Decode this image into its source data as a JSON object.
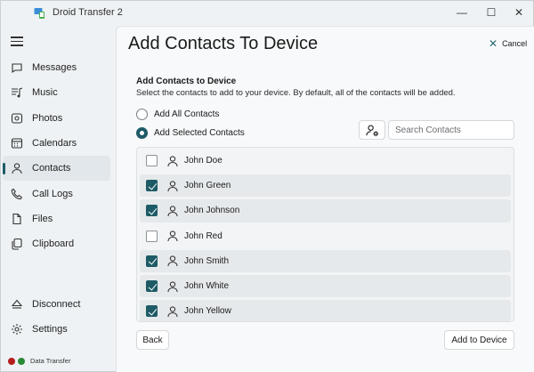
{
  "window": {
    "title": "Droid Transfer 2",
    "controls": {
      "minimize": "—",
      "maximize": "☐",
      "close": "✕"
    }
  },
  "sidebar": {
    "items": [
      {
        "label": "Messages",
        "icon": "messages-icon",
        "active": false
      },
      {
        "label": "Music",
        "icon": "music-icon",
        "active": false
      },
      {
        "label": "Photos",
        "icon": "photos-icon",
        "active": false
      },
      {
        "label": "Calendars",
        "icon": "calendar-icon",
        "active": false
      },
      {
        "label": "Contacts",
        "icon": "contacts-icon",
        "active": true
      },
      {
        "label": "Call Logs",
        "icon": "phone-icon",
        "active": false
      },
      {
        "label": "Files",
        "icon": "file-icon",
        "active": false
      },
      {
        "label": "Clipboard",
        "icon": "clipboard-icon",
        "active": false
      }
    ],
    "bottom_items": [
      {
        "label": "Disconnect",
        "icon": "eject-icon"
      },
      {
        "label": "Settings",
        "icon": "gear-icon"
      }
    ],
    "status": {
      "label": "Data Transfer",
      "colors": [
        "#b51c1c",
        "#2a8a36"
      ]
    }
  },
  "header": {
    "title": "Add Contacts To Device",
    "cancel_label": "Cancel"
  },
  "content": {
    "section_title": "Add Contacts to Device",
    "description": "Select the contacts to add to your device. By default, all of the contacts will be added.",
    "options": [
      {
        "label": "Add All Contacts",
        "checked": false
      },
      {
        "label": "Add Selected Contacts",
        "checked": true
      }
    ],
    "search": {
      "placeholder": "Search Contacts",
      "value": ""
    },
    "contacts": [
      {
        "name": "John Doe",
        "checked": false
      },
      {
        "name": "John Green",
        "checked": true
      },
      {
        "name": "John Johnson",
        "checked": true
      },
      {
        "name": "John Red",
        "checked": false
      },
      {
        "name": "John Smith",
        "checked": true
      },
      {
        "name": "John White",
        "checked": true
      },
      {
        "name": "John Yellow",
        "checked": true
      }
    ]
  },
  "footer": {
    "back_label": "Back",
    "add_label": "Add to Device"
  },
  "colors": {
    "accent": "#1e5b66",
    "background": "#eef2f4",
    "panel": "#f7f9fa"
  }
}
